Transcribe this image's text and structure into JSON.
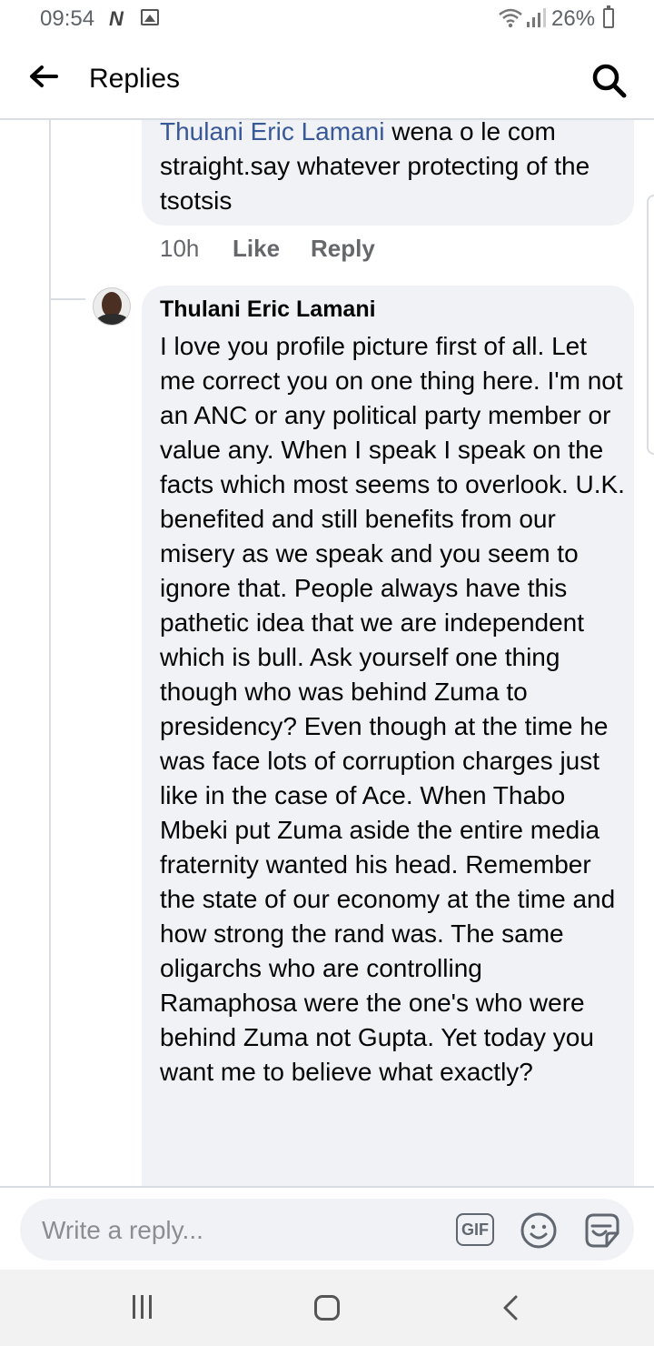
{
  "status_bar": {
    "time": "09:54",
    "battery": "26%"
  },
  "header": {
    "title": "Replies",
    "back_icon": "arrow-left-icon",
    "search_icon": "search-icon"
  },
  "comments": [
    {
      "mention": "Thulani Eric Lamani",
      "text_after_mention": " wena o le com straight.say whatever  protecting of the tsotsis",
      "time": "10h",
      "like_label": "Like",
      "reply_label": "Reply"
    },
    {
      "author": "Thulani Eric Lamani",
      "text": "I love you profile picture first of all. Let me correct you on one thing here. I'm not an ANC or any political party member or value any. When I speak I speak on the facts which most seems to overlook. U.K. benefited and still benefits from our misery as we speak and you seem to ignore that. People always have this pathetic idea that we are independent which is bull. Ask yourself one thing though who was behind Zuma to presidency? Even though at the time he was face lots of corruption charges just like in the case of Ace. When Thabo Mbeki put Zuma aside the entire media fraternity wanted his head. Remember the state of our economy at the time and how strong the rand was. The same oligarchs who are controlling Ramaphosa were the one's who were behind Zuma not Gupta. Yet today you want me to believe what exactly?"
    }
  ],
  "composer": {
    "placeholder": "Write a reply...",
    "gif_label": "GIF",
    "emoji_icon": "emoji-icon",
    "sticker_icon": "sticker-icon"
  },
  "nav": {
    "recent_icon": "recent-apps-icon",
    "home_icon": "home-icon",
    "back_icon": "back-chevron-icon"
  }
}
